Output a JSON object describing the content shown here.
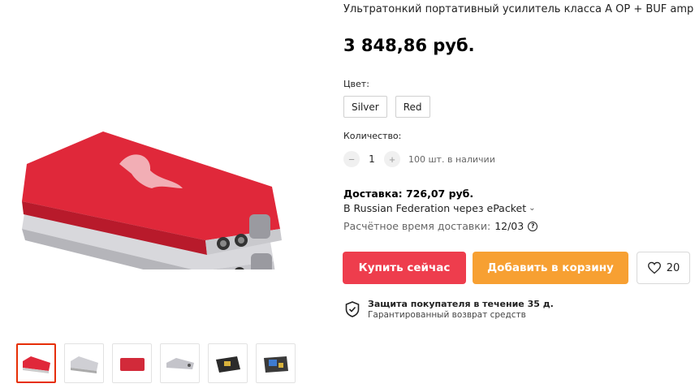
{
  "product": {
    "title": "Ультратонкий портативный усилитель класса А OP + BUF amp",
    "price": "3 848,86 руб."
  },
  "color": {
    "label": "Цвет:",
    "options": [
      "Silver",
      "Red"
    ]
  },
  "quantity": {
    "label": "Количество:",
    "minus": "−",
    "value": "1",
    "plus": "+",
    "stock": "100 шт. в наличии"
  },
  "delivery": {
    "cost": "Доставка: 726,07 руб.",
    "route": "В Russian Federation через ePacket",
    "eta_label": "Расчётное время доставки:",
    "eta_value": "12/03"
  },
  "actions": {
    "buy": "Купить сейчас",
    "cart": "Добавить в корзину",
    "wish_count": "20"
  },
  "protection": {
    "title": "Защита покупателя в течение 35 д.",
    "subtitle": "Гарантированный возврат средств"
  },
  "icons": {
    "chevron": "chevron-down-icon",
    "question": "question-icon",
    "heart": "heart-icon",
    "shield": "shield-check-icon"
  },
  "colors": {
    "buy": "#ee3d4d",
    "cart": "#f7a032",
    "active_thumb": "#e62e04",
    "device_red": "#e0283a"
  }
}
